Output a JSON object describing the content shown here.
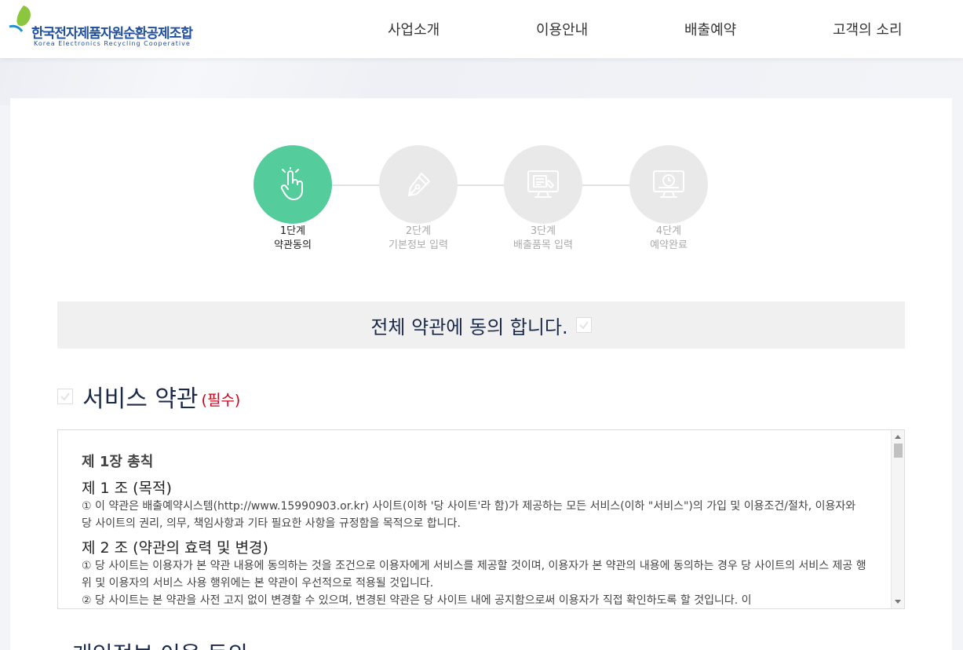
{
  "header": {
    "logo_kr": "한국전자제품자원순환공제조합",
    "logo_en": "Korea Electronics Recycling Cooperative",
    "nav": [
      "사업소개",
      "이용안내",
      "배출예약",
      "고객의 소리"
    ]
  },
  "steps": [
    {
      "num": "1단계",
      "name": "약관동의",
      "active": true,
      "icon": "hand-pointer-icon"
    },
    {
      "num": "2단계",
      "name": "기본정보 입력",
      "active": false,
      "icon": "pen-nib-icon"
    },
    {
      "num": "3단계",
      "name": "배출품목 입력",
      "active": false,
      "icon": "monitor-form-icon"
    },
    {
      "num": "4단계",
      "name": "예약완료",
      "active": false,
      "icon": "monitor-clock-icon"
    }
  ],
  "agree_all": {
    "label": "전체 약관에 동의 합니다.",
    "checked": false
  },
  "service_terms": {
    "title": "서비스 약관",
    "required": "(필수)",
    "checked": false,
    "chapter": "제 1장 총칙",
    "articles": [
      {
        "title": "제 1 조 (목적)",
        "paragraphs": [
          "① 이 약관은 배출예약시스템(http://www.15990903.or.kr) 사이트(이하 '당 사이트'라 함)가 제공하는 모든 서비스(이하 \"서비스\")의 가입 및 이용조건/절차, 이용자와 당 사이트의 권리, 의무, 책임사항과 기타 필요한 사항을 규정함을 목적으로 합니다."
        ]
      },
      {
        "title": "제 2 조 (약관의 효력 및 변경)",
        "paragraphs": [
          "① 당 사이트는 이용자가 본 약관 내용에 동의하는 것을 조건으로 이용자에게 서비스를 제공할 것이며, 이용자가 본 약관의 내용에 동의하는 경우 당 사이트의 서비스 제공 행위 및 이용자의 서비스 사용 행위에는 본 약관이 우선적으로 적용될 것입니다.",
          "② 당 사이트는 본 약관을 사전 고지 없이 변경할 수 있으며, 변경된 약관은 당 사이트 내에 공지함으로써 이용자가 직접 확인하도록 할 것입니다. 이"
        ]
      }
    ]
  },
  "next_section_title": "개인정보 이용 동의",
  "colors": {
    "accent": "#54cc9b",
    "navy": "#1c2a4a",
    "required": "#d0021b",
    "logo": "#1f4e9c"
  }
}
